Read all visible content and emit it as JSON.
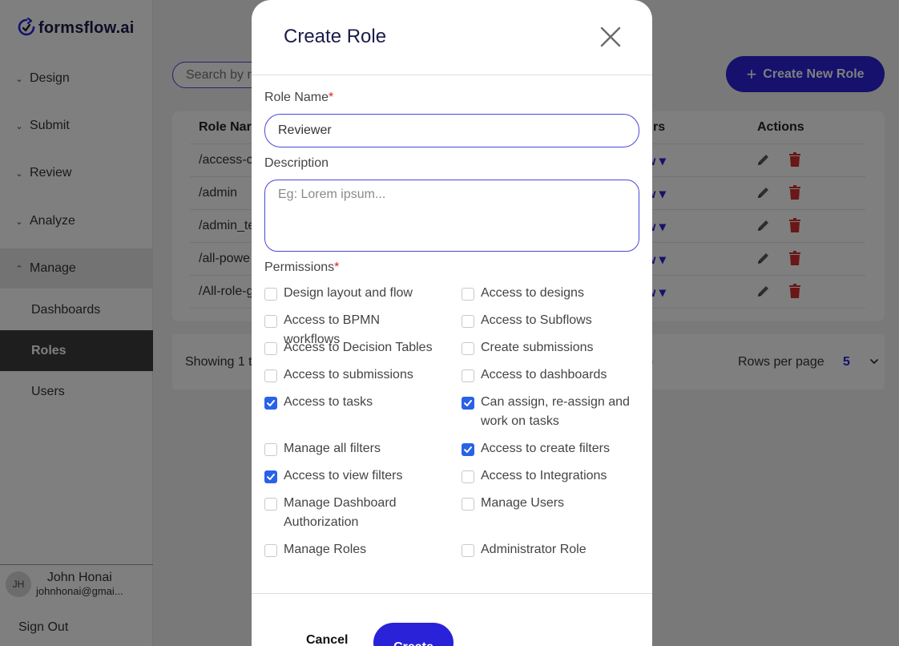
{
  "app": {
    "logo_text": "formsflow.ai"
  },
  "sidebar": {
    "items": [
      {
        "label": "Design",
        "chevron": "chevron-down"
      },
      {
        "label": "Submit",
        "chevron": "chevron-down"
      },
      {
        "label": "Review",
        "chevron": "chevron-down"
      },
      {
        "label": "Analyze",
        "chevron": "chevron-down"
      },
      {
        "label": "Manage",
        "chevron": "chevron-up",
        "open": true
      }
    ],
    "sub_items": [
      {
        "label": "Dashboards"
      },
      {
        "label": "Roles",
        "active": true
      },
      {
        "label": "Users"
      }
    ],
    "user": {
      "initials": "JH",
      "name": "John Honai",
      "email": "johnhonai@gmai..."
    },
    "sign_out": "Sign Out"
  },
  "main": {
    "search_placeholder": "Search by r",
    "create_new_label": "Create New Role",
    "table": {
      "headers": {
        "name": "Role Nar",
        "users": "rs",
        "actions": "Actions"
      },
      "rows": [
        {
          "name": "/access-c",
          "users": "w"
        },
        {
          "name": "/admin",
          "users": "w"
        },
        {
          "name": "/admin_te",
          "users": "w"
        },
        {
          "name": "/all-powe",
          "users": "w"
        },
        {
          "name": "/All-role-g",
          "users": "w"
        }
      ]
    },
    "pager": {
      "showing": "Showing 1 t",
      "showing_end": ")",
      "rows_per_page_label": "Rows per page",
      "rows_per_page_value": "5"
    }
  },
  "modal": {
    "title": "Create Role",
    "role_name_label": "Role Name",
    "required_mark": "*",
    "role_name_value": "Reviewer",
    "description_label": "Description",
    "description_placeholder": "Eg: Lorem ipsum...",
    "permissions_label": "Permissions",
    "permissions": [
      {
        "label": "Design layout and flow",
        "checked": false
      },
      {
        "label": "Access to designs",
        "checked": false
      },
      {
        "label": "Access to BPMN workflows",
        "checked": false
      },
      {
        "label": "Access to Subflows",
        "checked": false
      },
      {
        "label": "Access to Decision Tables",
        "checked": false
      },
      {
        "label": "Create submissions",
        "checked": false
      },
      {
        "label": "Access to submissions",
        "checked": false
      },
      {
        "label": "Access to dashboards",
        "checked": false
      },
      {
        "label": "Access to tasks",
        "checked": true
      },
      {
        "label": "Can assign, re-assign and work on tasks",
        "checked": true
      },
      {
        "label": "Manage all filters",
        "checked": false
      },
      {
        "label": "Access to create filters",
        "checked": true
      },
      {
        "label": "Access to view filters",
        "checked": true
      },
      {
        "label": "Access to Integrations",
        "checked": false
      },
      {
        "label": "Manage Dashboard Authorization",
        "checked": false
      },
      {
        "label": "Manage Users",
        "checked": false
      },
      {
        "label": "Manage Roles",
        "checked": false
      },
      {
        "label": "Administrator Role",
        "checked": false
      }
    ],
    "cancel_label": "Cancel",
    "create_label": "Create"
  },
  "colors": {
    "primary": "#2a22d8",
    "checkbox_checked": "#2962e8",
    "delete_icon": "#d32f2f",
    "active_nav_bg": "#3d3d3d",
    "required": "#e02020"
  }
}
